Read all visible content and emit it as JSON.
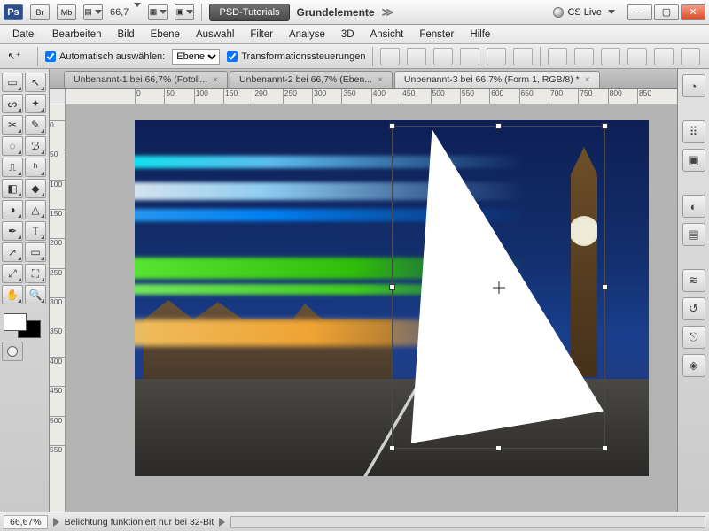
{
  "titlebar": {
    "app": "Ps",
    "btn_br": "Br",
    "btn_mb": "Mb",
    "zoom": "66,7",
    "workspace_btn": "PSD-Tutorials",
    "crumb": "Grundelemente",
    "cslive": "CS Live"
  },
  "menu": [
    "Datei",
    "Bearbeiten",
    "Bild",
    "Ebene",
    "Auswahl",
    "Filter",
    "Analyse",
    "3D",
    "Ansicht",
    "Fenster",
    "Hilfe"
  ],
  "options": {
    "auto_select_label": "Automatisch auswählen:",
    "auto_select_value": "Ebene",
    "transform_label": "Transformationssteuerungen"
  },
  "doc_tabs": [
    {
      "label": "Unbenannt-1 bei 66,7% (Fotoli..."
    },
    {
      "label": "Unbenannt-2 bei 66,7% (Eben..."
    },
    {
      "label": "Unbenannt-3 bei 66,7% (Form 1, RGB/8) *"
    }
  ],
  "active_tab": 2,
  "ruler_ticks_h": [
    0,
    50,
    100,
    150,
    200,
    250,
    300,
    350,
    400,
    450,
    500,
    550,
    600,
    650,
    700,
    750,
    800,
    850
  ],
  "ruler_ticks_v": [
    0,
    50,
    100,
    150,
    200,
    250,
    300,
    350,
    400,
    450,
    500,
    550
  ],
  "status": {
    "zoom": "66,67%",
    "msg": "Belichtung funktioniert nur bei 32-Bit"
  },
  "tool_names": [
    "rectangular-marquee",
    "move",
    "lasso",
    "magic-wand",
    "crop",
    "eyedropper",
    "spot-heal",
    "brush",
    "clone-stamp",
    "history-brush",
    "eraser",
    "paint-bucket",
    "dodge",
    "blur",
    "pen",
    "type",
    "path-select",
    "rectangle-shape",
    "3d-rotate",
    "3d-camera",
    "hand",
    "zoom"
  ],
  "tool_glyphs": [
    "▭",
    "↖",
    "ᔕ",
    "✦",
    "✂",
    "✎",
    "◌",
    "ℬ",
    "⎍",
    "ʰ",
    "◧",
    "◆",
    "◑",
    "△",
    "✒",
    "T",
    "↗",
    "▭",
    "⤢",
    "⛶",
    "✋",
    "🔍"
  ],
  "rdock": [
    {
      "name": "color-panel",
      "glyph": "◔"
    },
    {
      "name": "swatches-panel",
      "glyph": "⠿"
    },
    {
      "name": "adjustments-panel",
      "glyph": "▣"
    },
    {
      "name": "masks-panel",
      "glyph": "◐"
    },
    {
      "name": "layers-panel",
      "glyph": "▤"
    },
    {
      "name": "channels-panel",
      "glyph": "≋"
    },
    {
      "name": "history-panel",
      "glyph": "↺"
    },
    {
      "name": "paths-panel",
      "glyph": "⎋"
    },
    {
      "name": "styles-panel",
      "glyph": "◈"
    }
  ]
}
